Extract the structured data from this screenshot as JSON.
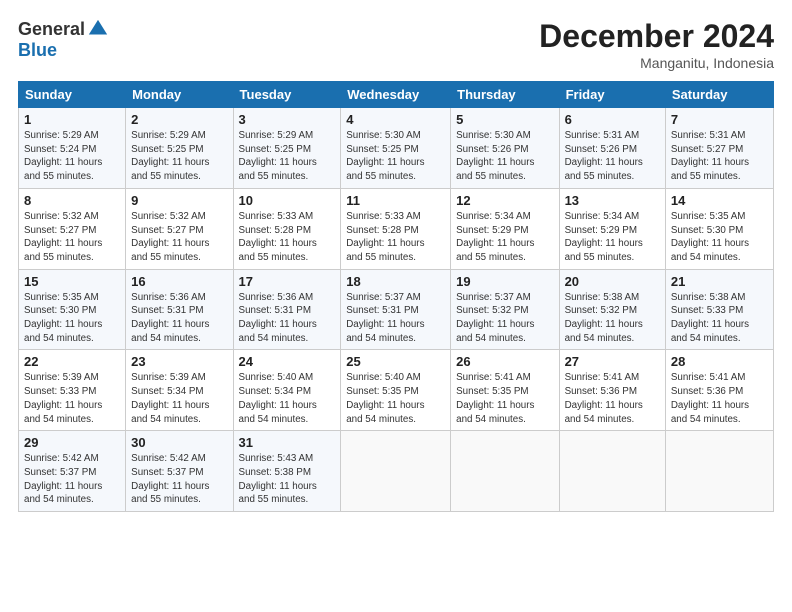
{
  "logo": {
    "general": "General",
    "blue": "Blue"
  },
  "header": {
    "month": "December 2024",
    "location": "Manganitu, Indonesia"
  },
  "weekdays": [
    "Sunday",
    "Monday",
    "Tuesday",
    "Wednesday",
    "Thursday",
    "Friday",
    "Saturday"
  ],
  "weeks": [
    [
      {
        "day": "1",
        "info": "Sunrise: 5:29 AM\nSunset: 5:24 PM\nDaylight: 11 hours\nand 55 minutes."
      },
      {
        "day": "2",
        "info": "Sunrise: 5:29 AM\nSunset: 5:25 PM\nDaylight: 11 hours\nand 55 minutes."
      },
      {
        "day": "3",
        "info": "Sunrise: 5:29 AM\nSunset: 5:25 PM\nDaylight: 11 hours\nand 55 minutes."
      },
      {
        "day": "4",
        "info": "Sunrise: 5:30 AM\nSunset: 5:25 PM\nDaylight: 11 hours\nand 55 minutes."
      },
      {
        "day": "5",
        "info": "Sunrise: 5:30 AM\nSunset: 5:26 PM\nDaylight: 11 hours\nand 55 minutes."
      },
      {
        "day": "6",
        "info": "Sunrise: 5:31 AM\nSunset: 5:26 PM\nDaylight: 11 hours\nand 55 minutes."
      },
      {
        "day": "7",
        "info": "Sunrise: 5:31 AM\nSunset: 5:27 PM\nDaylight: 11 hours\nand 55 minutes."
      }
    ],
    [
      {
        "day": "8",
        "info": "Sunrise: 5:32 AM\nSunset: 5:27 PM\nDaylight: 11 hours\nand 55 minutes."
      },
      {
        "day": "9",
        "info": "Sunrise: 5:32 AM\nSunset: 5:27 PM\nDaylight: 11 hours\nand 55 minutes."
      },
      {
        "day": "10",
        "info": "Sunrise: 5:33 AM\nSunset: 5:28 PM\nDaylight: 11 hours\nand 55 minutes."
      },
      {
        "day": "11",
        "info": "Sunrise: 5:33 AM\nSunset: 5:28 PM\nDaylight: 11 hours\nand 55 minutes."
      },
      {
        "day": "12",
        "info": "Sunrise: 5:34 AM\nSunset: 5:29 PM\nDaylight: 11 hours\nand 55 minutes."
      },
      {
        "day": "13",
        "info": "Sunrise: 5:34 AM\nSunset: 5:29 PM\nDaylight: 11 hours\nand 55 minutes."
      },
      {
        "day": "14",
        "info": "Sunrise: 5:35 AM\nSunset: 5:30 PM\nDaylight: 11 hours\nand 54 minutes."
      }
    ],
    [
      {
        "day": "15",
        "info": "Sunrise: 5:35 AM\nSunset: 5:30 PM\nDaylight: 11 hours\nand 54 minutes."
      },
      {
        "day": "16",
        "info": "Sunrise: 5:36 AM\nSunset: 5:31 PM\nDaylight: 11 hours\nand 54 minutes."
      },
      {
        "day": "17",
        "info": "Sunrise: 5:36 AM\nSunset: 5:31 PM\nDaylight: 11 hours\nand 54 minutes."
      },
      {
        "day": "18",
        "info": "Sunrise: 5:37 AM\nSunset: 5:31 PM\nDaylight: 11 hours\nand 54 minutes."
      },
      {
        "day": "19",
        "info": "Sunrise: 5:37 AM\nSunset: 5:32 PM\nDaylight: 11 hours\nand 54 minutes."
      },
      {
        "day": "20",
        "info": "Sunrise: 5:38 AM\nSunset: 5:32 PM\nDaylight: 11 hours\nand 54 minutes."
      },
      {
        "day": "21",
        "info": "Sunrise: 5:38 AM\nSunset: 5:33 PM\nDaylight: 11 hours\nand 54 minutes."
      }
    ],
    [
      {
        "day": "22",
        "info": "Sunrise: 5:39 AM\nSunset: 5:33 PM\nDaylight: 11 hours\nand 54 minutes."
      },
      {
        "day": "23",
        "info": "Sunrise: 5:39 AM\nSunset: 5:34 PM\nDaylight: 11 hours\nand 54 minutes."
      },
      {
        "day": "24",
        "info": "Sunrise: 5:40 AM\nSunset: 5:34 PM\nDaylight: 11 hours\nand 54 minutes."
      },
      {
        "day": "25",
        "info": "Sunrise: 5:40 AM\nSunset: 5:35 PM\nDaylight: 11 hours\nand 54 minutes."
      },
      {
        "day": "26",
        "info": "Sunrise: 5:41 AM\nSunset: 5:35 PM\nDaylight: 11 hours\nand 54 minutes."
      },
      {
        "day": "27",
        "info": "Sunrise: 5:41 AM\nSunset: 5:36 PM\nDaylight: 11 hours\nand 54 minutes."
      },
      {
        "day": "28",
        "info": "Sunrise: 5:41 AM\nSunset: 5:36 PM\nDaylight: 11 hours\nand 54 minutes."
      }
    ],
    [
      {
        "day": "29",
        "info": "Sunrise: 5:42 AM\nSunset: 5:37 PM\nDaylight: 11 hours\nand 54 minutes."
      },
      {
        "day": "30",
        "info": "Sunrise: 5:42 AM\nSunset: 5:37 PM\nDaylight: 11 hours\nand 55 minutes."
      },
      {
        "day": "31",
        "info": "Sunrise: 5:43 AM\nSunset: 5:38 PM\nDaylight: 11 hours\nand 55 minutes."
      },
      null,
      null,
      null,
      null
    ]
  ]
}
